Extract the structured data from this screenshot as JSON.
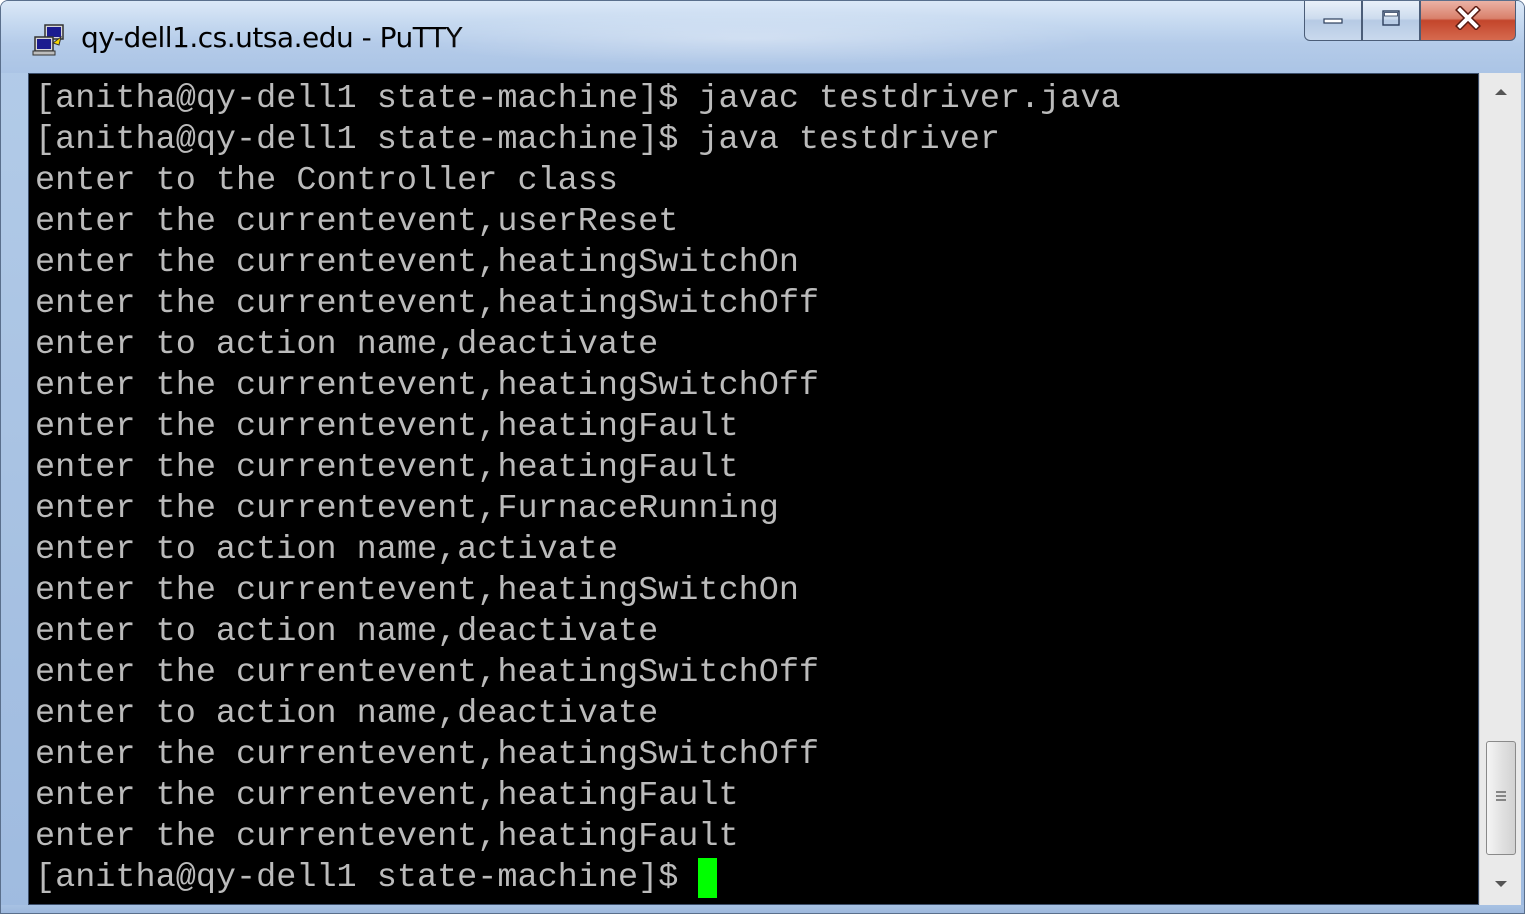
{
  "window": {
    "title": "qy-dell1.cs.utsa.edu - PuTTY"
  },
  "terminal": {
    "lines": [
      "[anitha@qy-dell1 state-machine]$ javac testdriver.java",
      "[anitha@qy-dell1 state-machine]$ java testdriver",
      "enter to the Controller class",
      "enter the currentevent,userReset",
      "enter the currentevent,heatingSwitchOn",
      "enter the currentevent,heatingSwitchOff",
      "enter to action name,deactivate",
      "enter the currentevent,heatingSwitchOff",
      "enter the currentevent,heatingFault",
      "enter the currentevent,heatingFault",
      "enter the currentevent,FurnaceRunning",
      "enter to action name,activate",
      "enter the currentevent,heatingSwitchOn",
      "enter to action name,deactivate",
      "enter the currentevent,heatingSwitchOff",
      "enter to action name,deactivate",
      "enter the currentevent,heatingSwitchOff",
      "enter the currentevent,heatingFault",
      "enter the currentevent,heatingFault",
      "[anitha@qy-dell1 state-machine]$"
    ],
    "text_color": "#bbbbbb",
    "background": "#000000",
    "cursor_color": "#00ff00"
  },
  "icons": {
    "app": "putty-icon",
    "minimize": "minimize-icon",
    "maximize": "maximize-icon",
    "close": "close-icon",
    "scroll_up": "arrow-up-icon",
    "scroll_down": "arrow-down-icon",
    "grip": "grip-icon"
  }
}
